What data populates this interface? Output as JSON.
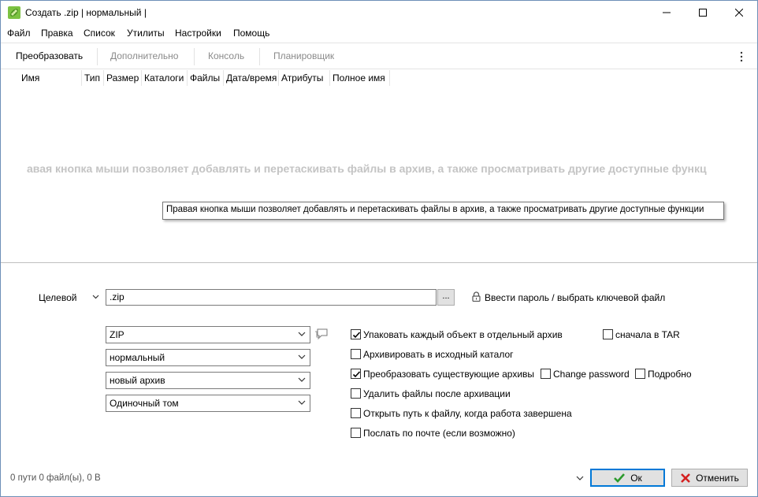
{
  "window": {
    "title": "Создать .zip | нормальный |",
    "controls": {
      "minimize": "minimize",
      "maximize": "maximize",
      "close": "close"
    }
  },
  "menu": [
    "Файл",
    "Правка",
    "Список",
    "Утилиты",
    "Настройки",
    "Помощь"
  ],
  "toolbar": {
    "tabs": [
      {
        "label": "Преобразовать",
        "active": true
      },
      {
        "label": "Дополнительно",
        "active": false
      },
      {
        "label": "Консоль",
        "active": false
      },
      {
        "label": "Планировщик",
        "active": false
      }
    ]
  },
  "filelist": {
    "columns": [
      "Имя",
      "Тип",
      "Размер",
      "Каталоги",
      "Файлы",
      "Дата/время",
      "Атрибуты",
      "Полное имя"
    ],
    "hint_text": "авая кнопка мыши позволяет добавлять и перетаскивать файлы в архив, а также просматривать другие доступные функц",
    "tooltip": "Правая кнопка мыши позволяет добавлять и перетаскивать файлы в архив, а также просматривать другие доступные функции"
  },
  "target": {
    "label": "Целевой",
    "value": ".zip",
    "browse_label": "...",
    "password_label": "Ввести пароль / выбрать ключевой файл"
  },
  "selects": {
    "format": "ZIP",
    "level": "нормальный",
    "mode": "новый архив",
    "volume": "Одиночный том"
  },
  "options": {
    "pack_each": {
      "label": "Упаковать каждый объект в отдельный архив",
      "checked": true
    },
    "tar_first": {
      "label": "сначала в TAR",
      "checked": false
    },
    "to_source": {
      "label": "Архивировать в исходный каталог",
      "checked": false
    },
    "convert_existing": {
      "label": "Преобразовать существующие архивы",
      "checked": true
    },
    "change_password": {
      "label": "Change password",
      "checked": false
    },
    "verbose": {
      "label": "Подробно",
      "checked": false
    },
    "delete_after": {
      "label": "Удалить файлы после архивации",
      "checked": false
    },
    "open_path": {
      "label": "Открыть путь к файлу, когда работа завершена",
      "checked": false
    },
    "send_mail": {
      "label": "Послать по почте (если возможно)",
      "checked": false
    }
  },
  "status": {
    "text": "0 пути 0 файл(ы), 0 В"
  },
  "buttons": {
    "ok": "Ок",
    "cancel": "Отменить"
  },
  "colors": {
    "ok_check": "#2c9a2c",
    "cancel_x": "#d42020",
    "focus_border": "#0078d7"
  }
}
